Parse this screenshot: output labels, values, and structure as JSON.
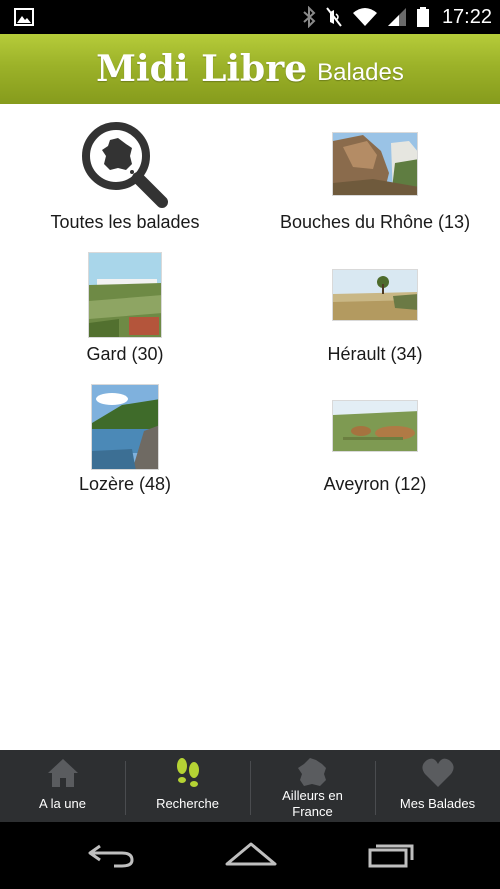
{
  "status_bar": {
    "time": "17:22",
    "icons": [
      "image-icon",
      "bluetooth-icon",
      "mute-icon",
      "wifi-icon",
      "signal-icon",
      "battery-icon"
    ]
  },
  "header": {
    "brand": "Midi Libre",
    "section": "Balades",
    "colors": {
      "top": "#b6cc3a",
      "bottom": "#869b1c"
    }
  },
  "regions": [
    {
      "label": "Toutes les balades",
      "icon": "search-france-icon"
    },
    {
      "label": "Bouches du Rhône (13)",
      "icon": "photo-thumbnail"
    },
    {
      "label": "Gard (30)",
      "icon": "photo-thumbnail"
    },
    {
      "label": "Hérault (34)",
      "icon": "photo-thumbnail"
    },
    {
      "label": "Lozère (48)",
      "icon": "photo-thumbnail"
    },
    {
      "label": "Aveyron (12)",
      "icon": "photo-thumbnail"
    }
  ],
  "tabs": [
    {
      "label": "A la une",
      "icon": "home-icon",
      "active": false
    },
    {
      "label": "Recherche",
      "icon": "footprints-icon",
      "active": true
    },
    {
      "label_line1": "Ailleurs en",
      "label_line2": "France",
      "icon": "france-map-icon",
      "active": false
    },
    {
      "label": "Mes Balades",
      "icon": "heart-icon",
      "active": false
    }
  ],
  "colors": {
    "accent": "#b5d334",
    "tabbar": "#2d2f31",
    "tab_icon_inactive": "#5a5c5f"
  },
  "nav": {
    "icons": [
      "back-icon",
      "home-nav-icon",
      "recents-icon"
    ]
  }
}
